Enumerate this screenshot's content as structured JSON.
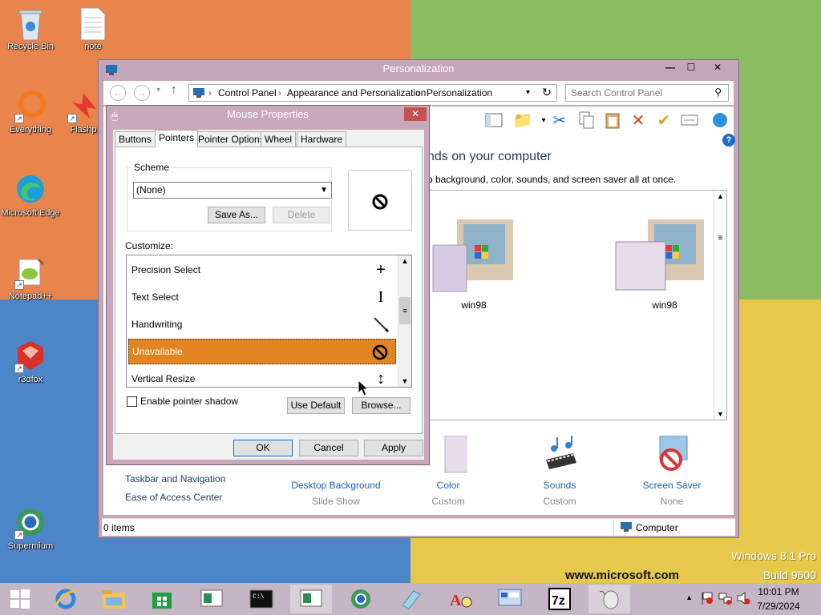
{
  "desktop": {
    "icons": [
      {
        "label": "Recycle Bin",
        "icon": "recycle-bin-icon"
      },
      {
        "label": "note",
        "icon": "document-icon"
      },
      {
        "label": "Everything",
        "icon": "everything-icon"
      },
      {
        "label": "Flashp",
        "icon": "flashpoint-icon"
      },
      {
        "label": "Microsoft Edge",
        "icon": "edge-icon"
      },
      {
        "label": "Notepad++",
        "icon": "notepad-plus-plus-icon"
      },
      {
        "label": "r3dfox",
        "icon": "r3dfox-icon"
      },
      {
        "label": "Supermium",
        "icon": "supermium-icon"
      }
    ],
    "watermark": {
      "line1": "Windows 8.1 Pro",
      "line2": "Build 9600"
    },
    "url_text": "www.microsoft.com"
  },
  "personalization": {
    "title": "Personalization",
    "breadcrumbs": [
      "Control Panel",
      "Appearance and Personalization",
      "Personalization"
    ],
    "search_placeholder": "Search Control Panel",
    "heading": "nds on your computer",
    "subheading": "p background, color, sounds, and screen saver all at once.",
    "themes": [
      {
        "label": "win98"
      },
      {
        "label": "win98"
      }
    ],
    "bottom_items": [
      {
        "title": "Desktop Background",
        "sub": "Slide Show"
      },
      {
        "title": "Color",
        "sub": "Custom"
      },
      {
        "title": "Sounds",
        "sub": "Custom"
      },
      {
        "title": "Screen Saver",
        "sub": "None"
      }
    ],
    "see_also": [
      "Taskbar and Navigation",
      "Ease of Access Center"
    ],
    "status_items": "0 items",
    "status_computer": "Computer"
  },
  "mouse_properties": {
    "title": "Mouse Properties",
    "tabs": [
      "Buttons",
      "Pointers",
      "Pointer Options",
      "Wheel",
      "Hardware"
    ],
    "active_tab": "Pointers",
    "scheme_label": "Scheme",
    "scheme_value": "(None)",
    "save_as": "Save As...",
    "delete": "Delete",
    "customize_label": "Customize:",
    "pointers": [
      {
        "name": "Precision Select",
        "glyph": "+"
      },
      {
        "name": "Text Select",
        "glyph": "I"
      },
      {
        "name": "Handwriting",
        "glyph": "╲"
      },
      {
        "name": "Unavailable",
        "glyph": "⃠"
      },
      {
        "name": "Vertical Resize",
        "glyph": "↕"
      }
    ],
    "selected_pointer": "Unavailable",
    "shadow_label": "Enable pointer shadow",
    "use_default": "Use Default",
    "browse": "Browse...",
    "ok": "OK",
    "cancel": "Cancel",
    "apply": "Apply"
  },
  "taskbar": {
    "time": "10:01 PM",
    "date": "7/29/2024"
  },
  "colors": {
    "title_bar": "#c4a6b8",
    "selection": "#e2841f",
    "link": "#1f5fb0"
  }
}
